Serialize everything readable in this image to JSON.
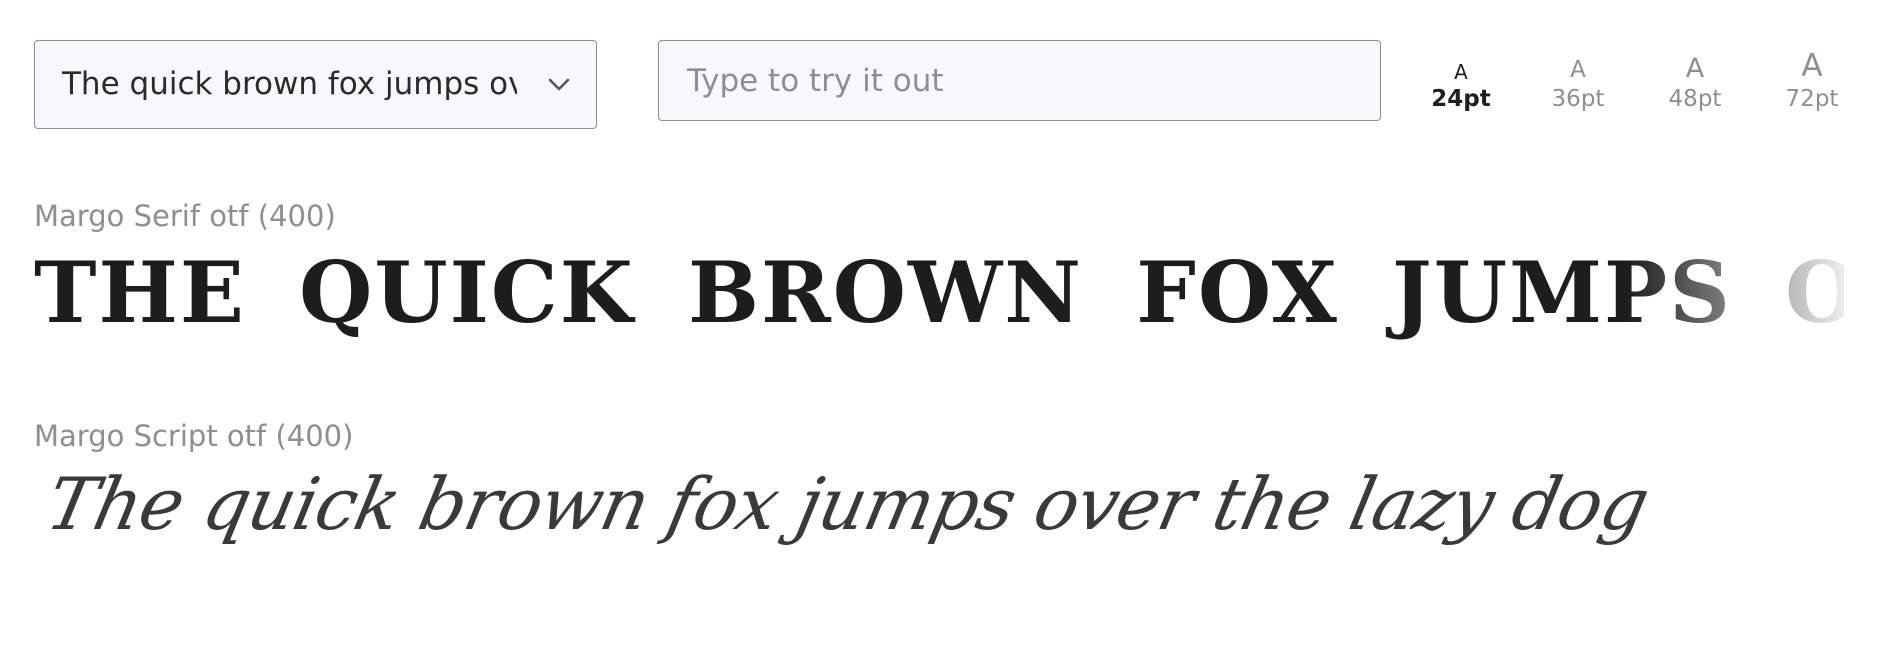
{
  "preview_controls": {
    "preset_selected": "The quick brown fox jumps over the lazy dog",
    "preset_icon": "chevron-down-icon",
    "try_input": {
      "value": "",
      "placeholder": "Type to try it out"
    },
    "sizes": [
      {
        "glyph": "A",
        "label": "24pt",
        "active": true
      },
      {
        "glyph": "A",
        "label": "36pt",
        "active": false
      },
      {
        "glyph": "A",
        "label": "48pt",
        "active": false
      },
      {
        "glyph": "A",
        "label": "72pt",
        "active": false
      }
    ]
  },
  "specimens": [
    {
      "name": "Margo Serif otf (400)",
      "sample": "THE QUICK BROWN FOX JUMPS OVE"
    },
    {
      "name": "Margo Script otf (400)",
      "sample": "The quick brown fox jumps over the lazy dog"
    }
  ],
  "colors": {
    "muted_text": "#8b8f96",
    "active_text": "#1f1f1f",
    "field_border": "#8a8f98",
    "field_bg": "#f8f8fb"
  }
}
